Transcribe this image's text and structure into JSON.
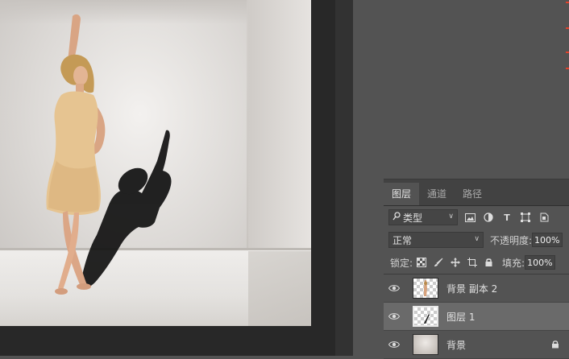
{
  "colors": {
    "panel_bg": "#535353",
    "tab_bar_bg": "#424242",
    "selected_row_bg": "#6a6a6a",
    "canvas_surround": "#282828",
    "edge_marker": "#e1422b"
  },
  "layers_panel": {
    "tabs": [
      {
        "label": "图层",
        "active": true
      },
      {
        "label": "通道",
        "active": false
      },
      {
        "label": "路径",
        "active": false
      }
    ],
    "filter": {
      "search_icon": "search-icon",
      "kind_label": "类型",
      "icons": [
        "image-filter-icon",
        "adjustment-filter-icon",
        "type-filter-icon",
        "shape-filter-icon",
        "smart-object-filter-icon"
      ]
    },
    "blend": {
      "mode": "正常",
      "opacity_label": "不透明度:",
      "opacity_value": "100%"
    },
    "lock": {
      "label": "锁定:",
      "icons": [
        "lock-transparent-icon",
        "lock-paint-icon",
        "lock-move-icon",
        "lock-artboard-icon",
        "lock-all-icon"
      ],
      "fill_label": "填充:",
      "fill_value": "100%"
    },
    "layers": [
      {
        "name": "背景 副本 2",
        "visible": true,
        "selected": false,
        "locked": false,
        "thumb": "woman-cutout"
      },
      {
        "name": "图层 1",
        "visible": true,
        "selected": true,
        "locked": false,
        "thumb": "shadow"
      },
      {
        "name": "背景",
        "visible": true,
        "selected": false,
        "locked": true,
        "thumb": "room"
      }
    ]
  }
}
